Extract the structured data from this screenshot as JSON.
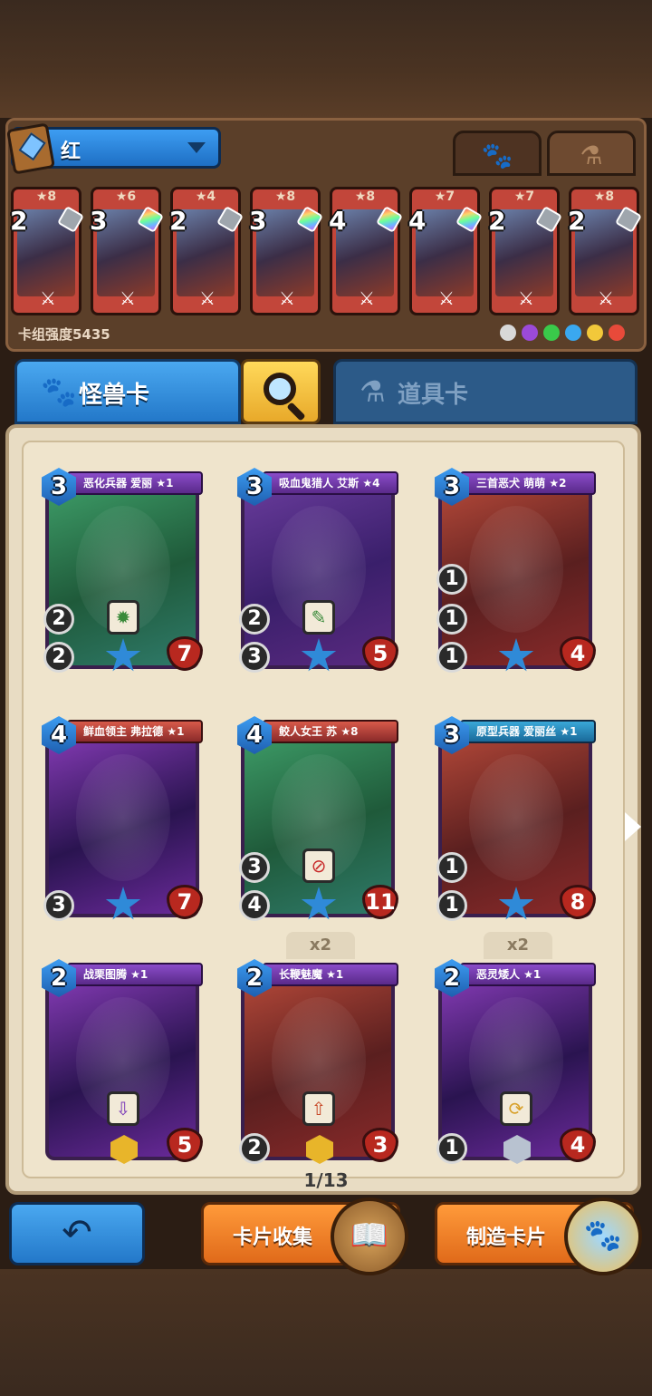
{
  "deck": {
    "name": "红",
    "power_label": "卡组强度5435",
    "mini_cards": [
      {
        "cost": "2",
        "stars": "★8",
        "gem": "grey"
      },
      {
        "cost": "3",
        "stars": "★6",
        "gem": "rainbow"
      },
      {
        "cost": "2",
        "stars": "★4",
        "gem": "grey"
      },
      {
        "cost": "3",
        "stars": "★8",
        "gem": "rainbow"
      },
      {
        "cost": "4",
        "stars": "★8",
        "gem": "rainbow"
      },
      {
        "cost": "4",
        "stars": "★7",
        "gem": "rainbow"
      },
      {
        "cost": "2",
        "stars": "★7",
        "gem": "grey"
      },
      {
        "cost": "2",
        "stars": "★8",
        "gem": "grey"
      }
    ],
    "element_colors": [
      "#d8d8d8",
      "#9b4ad8",
      "#3ac94a",
      "#3aa8f0",
      "#f2c83a",
      "#e84a3a"
    ]
  },
  "type_tabs": {
    "paw_icon": "🐾",
    "potion_icon": "⚗"
  },
  "category_tabs": {
    "monster_label": "怪兽卡",
    "item_label": "道具卡",
    "paw_icon": "🐾",
    "potion_icon": "⚗"
  },
  "cards": [
    {
      "name": "恶化兵器 爱丽 ★1",
      "cost": "3",
      "atk": "2",
      "def": "2",
      "hp": "7",
      "frame": "green",
      "banner": "purple"
    },
    {
      "name": "吸血鬼猎人 艾斯 ★4",
      "cost": "3",
      "atk": "3",
      "def": "2",
      "hp": "5",
      "frame": "purple",
      "banner": "purple"
    },
    {
      "name": "三首恶犬 萌萌 ★2",
      "cost": "3",
      "atk": "1",
      "def": "1",
      "def2": "1",
      "hp": "4",
      "frame": "red",
      "banner": "purple"
    },
    {
      "name": "鲜血领主 弗拉德 ★1",
      "cost": "4",
      "atk": "3",
      "hp": "7",
      "frame": "violet",
      "banner": "red"
    },
    {
      "name": "鲛人女王 苏 ★8",
      "cost": "4",
      "atk": "4",
      "def": "3",
      "hp": "11",
      "frame": "green",
      "banner": "red"
    },
    {
      "name": "原型兵器 爱丽丝 ★1",
      "cost": "3",
      "atk": "1",
      "def": "1",
      "hp": "8",
      "frame": "red",
      "banner": "teal"
    },
    {
      "name": "战栗图腾 ★1",
      "cost": "2",
      "hp": "5",
      "frame": "violet",
      "banner": "purple"
    },
    {
      "name": "长鞭魅魔 ★1",
      "cost": "2",
      "atk": "2",
      "hp": "3",
      "frame": "red",
      "banner": "purple",
      "dup": "x2"
    },
    {
      "name": "恶灵矮人 ★1",
      "cost": "2",
      "atk": "1",
      "hp": "4",
      "frame": "violet",
      "banner": "purple",
      "dup": "x2"
    }
  ],
  "pagination": {
    "label": "1/13"
  },
  "buttons": {
    "back_icon": "↶",
    "collect_label": "卡片收集",
    "craft_label": "制造卡片",
    "collect_icon": "📖",
    "craft_icon": "🐾"
  }
}
